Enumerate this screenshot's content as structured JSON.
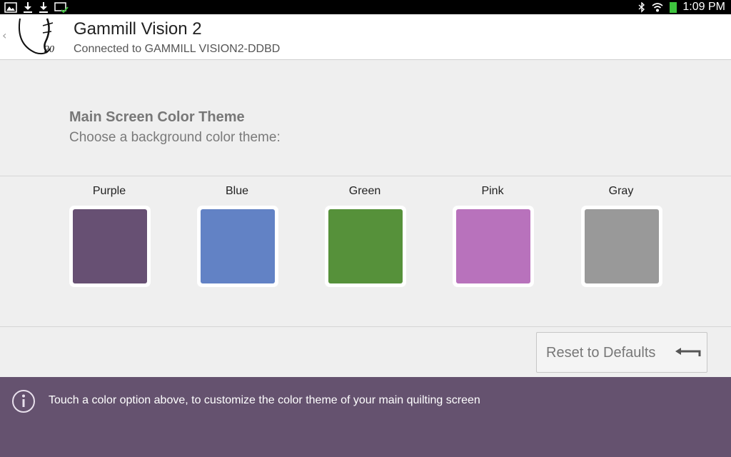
{
  "status_bar": {
    "time": "1:09 PM",
    "icons": [
      "image-icon",
      "download-icon",
      "download-icon",
      "cast-icon",
      "bluetooth-icon",
      "wifi-icon",
      "battery-icon"
    ],
    "battery_color": "#3ec43e"
  },
  "app": {
    "title": "Gammill Vision 2",
    "subtitle": "Connected to GAMMILL VISION2-DDBD",
    "logo_text": "20"
  },
  "section": {
    "title": "Main Screen Color Theme",
    "subtitle": "Choose a background color theme:"
  },
  "color_options": [
    {
      "label": "Purple",
      "color": "#675073"
    },
    {
      "label": "Blue",
      "color": "#6282c5"
    },
    {
      "label": "Green",
      "color": "#56913a"
    },
    {
      "label": "Pink",
      "color": "#b872bc"
    },
    {
      "label": "Gray",
      "color": "#999999"
    }
  ],
  "reset_button": {
    "label": "Reset to Defaults",
    "icon": "return-arrow-icon"
  },
  "info_bar": {
    "icon": "info-icon",
    "text": "Touch a color option above, to customize the color theme of your main quilting screen",
    "background": "#65526f"
  }
}
